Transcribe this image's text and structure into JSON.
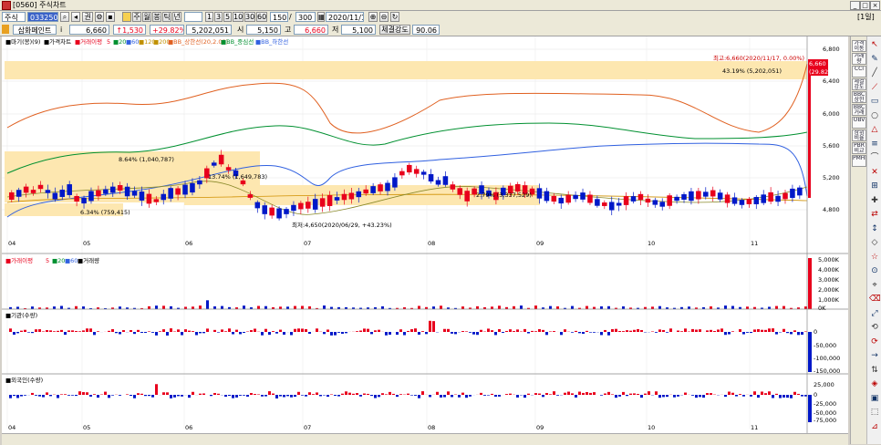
{
  "window": {
    "title": "[0560] 주식차트",
    "min": "_",
    "max": "□",
    "close": "×"
  },
  "toolbar": {
    "market": "주식",
    "code": "033250",
    "mode_label": "권",
    "period_buttons": [
      "주",
      "월",
      "봉",
      "틱",
      "년"
    ],
    "minute_buttons": [
      "1",
      "3",
      "5",
      "10",
      "30",
      "60"
    ],
    "count1": "150",
    "count2": "300",
    "date": "2020/11/17",
    "corner": "[1일]"
  },
  "quote": {
    "name": "삼화페인트",
    "price": "6,660",
    "change": "↑1,530",
    "rate": "+29.82%",
    "volume": "5,202,051",
    "open_label": "시",
    "open": "5,150",
    "high_label": "고",
    "high": "6,660",
    "low_label": "저",
    "low": "5,100",
    "strength_label": "체결강도",
    "strength": "90.06"
  },
  "legend_price": [
    "■마기(봉)(9)",
    "■가격차트",
    "■거래이평",
    "5",
    "■20",
    "■60",
    "■120",
    "■200",
    "■BB_상한선(20,2.00)",
    "■BB_중심선",
    "■BB_하한선"
  ],
  "legend_volume": [
    "■가래이평",
    "5",
    "■20",
    "■60",
    "■거래량"
  ],
  "legend_inst": "■기관(수량)",
  "legend_foreign": "■외국인(수량)",
  "annotations": {
    "high": "최고:6,660(2020/11/17, 0.00%)",
    "low": "최저:4,650(2020/06/29, +43.23%)",
    "b1": "43.19% (5,202,051)",
    "b2": "8.64% (1,040,787)",
    "b3": "13.74% (1,649,783)",
    "b4": "6.34% (759,415)",
    "b5": "2.79% (3,337,529)",
    "last_price": "6,660",
    "last_rate": "(29.82%)"
  },
  "axis": {
    "price_ticks": [
      "6,800",
      "6,400",
      "6,000",
      "5,600",
      "5,200",
      "4,800"
    ],
    "vol_ticks": [
      "5,000K",
      "4,000K",
      "3,000K",
      "2,000K",
      "1,000K",
      "0K"
    ],
    "inst_ticks": [
      "0",
      "-50,000",
      "-100,000",
      "-150,000"
    ],
    "foreign_ticks": [
      "25,000",
      "0",
      "-25,000",
      "-50,000",
      "-75,000"
    ],
    "months": [
      "04",
      "05",
      "06",
      "07",
      "08",
      "09",
      "10",
      "11"
    ]
  },
  "colors": {
    "up": "#e8001c",
    "down": "#0018c8",
    "band": "#fde7b0",
    "bb_upper": "#e06020",
    "bb_mid": "#009030",
    "bb_lower": "#3060e0"
  },
  "right_tools": [
    "가격 이동",
    "거래량",
    "CCI",
    "체결 강도",
    "BBC 상한",
    "BBC 거래",
    "OBV",
    "삼위 비율",
    "PBR 비교",
    "PMHE"
  ],
  "chart_data": {
    "type": "candlestick",
    "x": [
      "04",
      "05",
      "06",
      "07",
      "08",
      "09",
      "10",
      "11"
    ],
    "price_range": [
      4600,
      6850
    ],
    "last_close": 6660,
    "high": 6660,
    "low": 4650
  }
}
